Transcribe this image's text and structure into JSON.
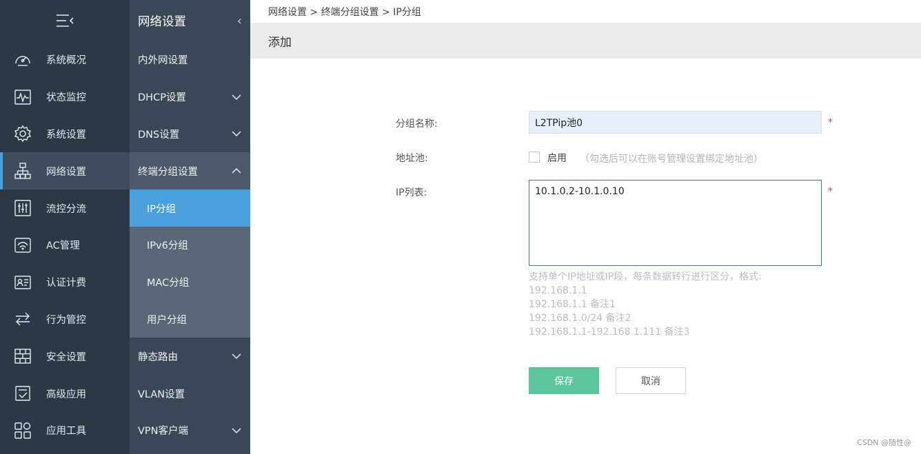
{
  "nav1": {
    "collapse_icon": "menu-collapse-icon",
    "items": [
      {
        "label": "系统概况",
        "icon": "dashboard-gauge-icon"
      },
      {
        "label": "状态监控",
        "icon": "monitor-pulse-icon"
      },
      {
        "label": "系统设置",
        "icon": "gear-icon"
      },
      {
        "label": "网络设置",
        "icon": "network-topology-icon",
        "active": true
      },
      {
        "label": "流控分流",
        "icon": "sliders-icon"
      },
      {
        "label": "AC管理",
        "icon": "wifi-router-icon"
      },
      {
        "label": "认证计费",
        "icon": "id-card-icon"
      },
      {
        "label": "行为管控",
        "icon": "swap-arrows-icon"
      },
      {
        "label": "安全设置",
        "icon": "firewall-icon"
      },
      {
        "label": "高级应用",
        "icon": "checklist-icon"
      },
      {
        "label": "应用工具",
        "icon": "toolbox-icon"
      }
    ]
  },
  "nav2": {
    "title": "网络设置",
    "items": [
      {
        "label": "内外网设置"
      },
      {
        "label": "DHCP设置",
        "expandable": true
      },
      {
        "label": "DNS设置",
        "expandable": true
      },
      {
        "label": "终端分组设置",
        "expandable": true,
        "open": true
      }
    ],
    "sub_items": [
      {
        "label": "IP分组",
        "current": true
      },
      {
        "label": "IPv6分组"
      },
      {
        "label": "MAC分组"
      },
      {
        "label": "用户分组"
      }
    ],
    "items_after": [
      {
        "label": "静态路由",
        "expandable": true
      },
      {
        "label": "VLAN设置"
      },
      {
        "label": "VPN客户端",
        "expandable": true
      }
    ]
  },
  "breadcrumb": "网络设置 > 终端分组设置 > IP分组",
  "page_title": "添加",
  "form": {
    "group_name_label": "分组名称:",
    "group_name_value": "L2TPip池0",
    "pool_label": "地址池:",
    "pool_checked": false,
    "pool_enable_label": "启用",
    "pool_hint": "（勾选后可以在账号管理设置绑定地址池）",
    "ip_list_label": "IP列表:",
    "ip_list_value": "10.1.0.2-10.1.0.10",
    "required_mark": "*",
    "help_lines": [
      "支持单个IP地址或IP段，每条数据转行进行区分，格式:",
      "192.168.1.1",
      "192.168.1.1 备注1",
      "192.168.1.0/24 备注2",
      "192.168.1.1-192.168.1.111 备注3"
    ],
    "save_label": "保存",
    "cancel_label": "取消"
  },
  "watermark": "CSDN @随性@",
  "colors": {
    "nav1_bg": "#2b3947",
    "nav2_bg": "#3a4756",
    "accent_blue": "#4aa0dd",
    "save_green": "#5bc59c",
    "required_red": "#e34a4a"
  }
}
